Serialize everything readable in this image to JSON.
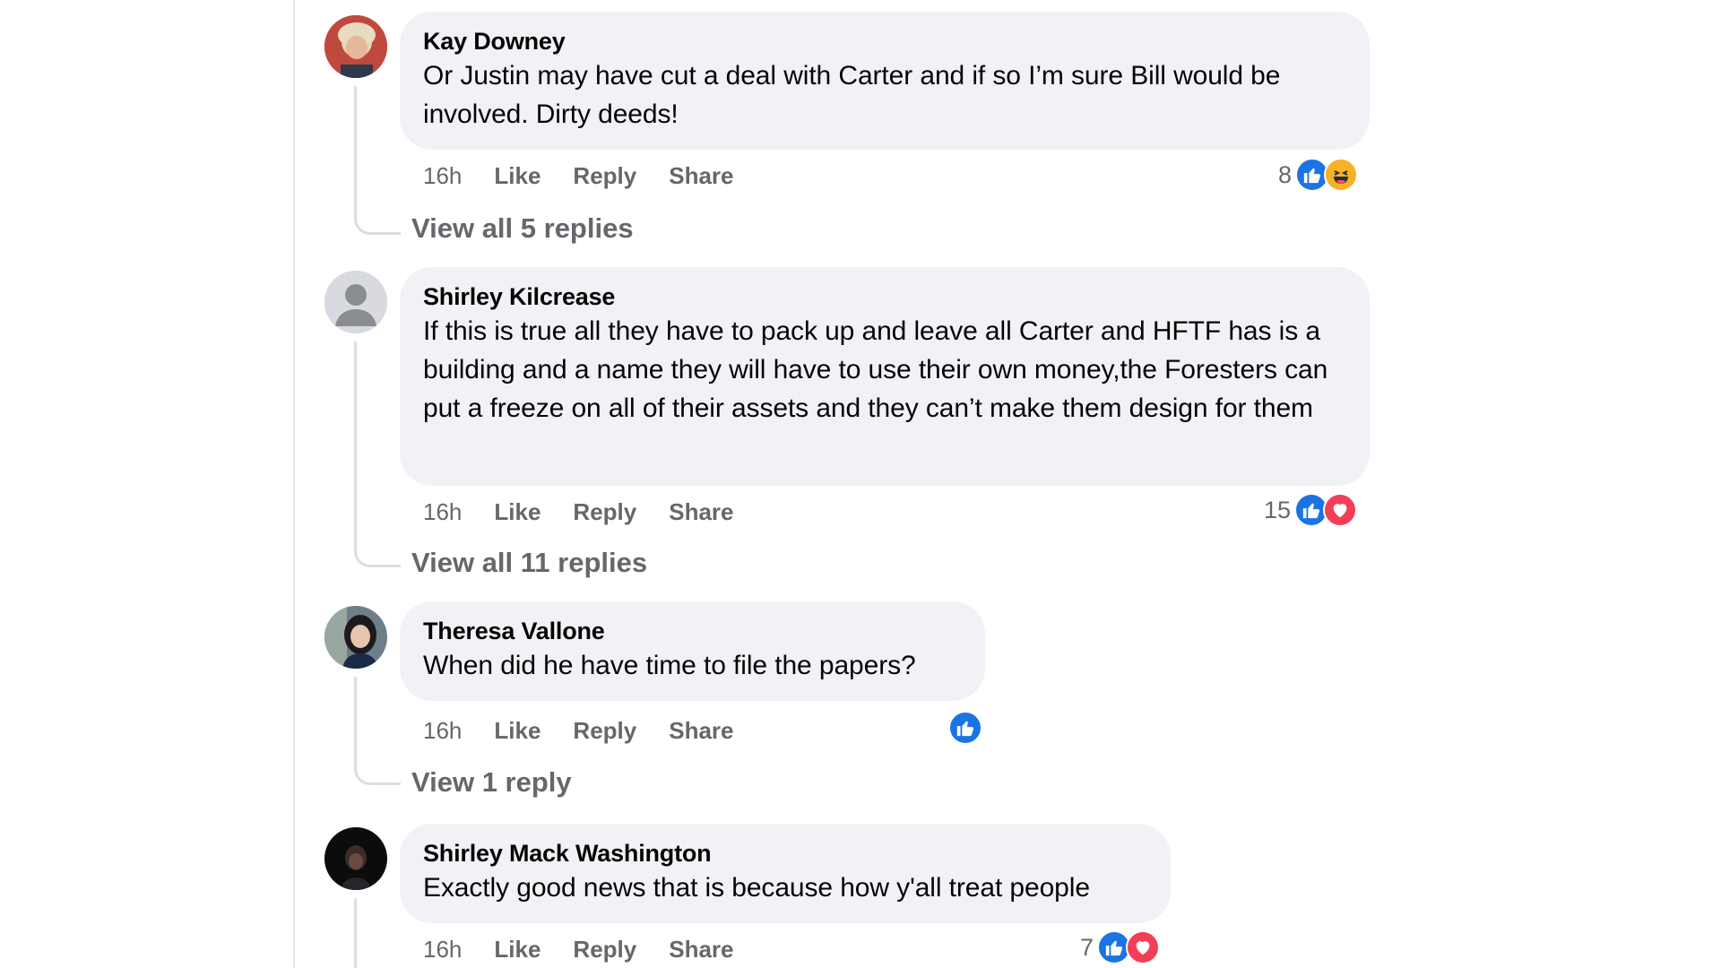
{
  "comments": [
    {
      "author": "Kay Downey",
      "text": "Or Justin may have cut a deal with Carter and if so I’m sure Bill would be involved. Dirty deeds!",
      "time": "16h",
      "like": "Like",
      "reply": "Reply",
      "share": "Share",
      "reaction_count": "8",
      "reaction_icons": [
        "like-icon",
        "haha-icon"
      ],
      "view_replies": "View all 5 replies"
    },
    {
      "author": "Shirley Kilcrease",
      "text": "If this is true all they have to pack up and leave all Carter and HFTF has is a building and a name they will have to use their own money,the Foresters can put a freeze on all of their assets and they can’t make them design for them",
      "time": "16h",
      "like": "Like",
      "reply": "Reply",
      "share": "Share",
      "reaction_count": "15",
      "reaction_icons": [
        "like-icon",
        "love-icon"
      ],
      "view_replies": "View all 11 replies"
    },
    {
      "author": "Theresa Vallone",
      "text": "When did he have time to file the papers?",
      "time": "16h",
      "like": "Like",
      "reply": "Reply",
      "share": "Share",
      "reaction_count": "",
      "reaction_icons": [
        "like-icon"
      ],
      "view_replies": "View 1 reply"
    },
    {
      "author": "Shirley Mack Washington",
      "text": "Exactly good news that is because how y'all treat people",
      "time": "16h",
      "like": "Like",
      "reply": "Reply",
      "share": "Share",
      "reaction_count": "7",
      "reaction_icons": [
        "like-icon",
        "love-icon"
      ]
    }
  ],
  "colors": {
    "bubble": "#f0f2f5",
    "meta_text": "#65676b",
    "like": "#1b74e4",
    "love": "#f33e58",
    "haha": "#f7b125"
  }
}
